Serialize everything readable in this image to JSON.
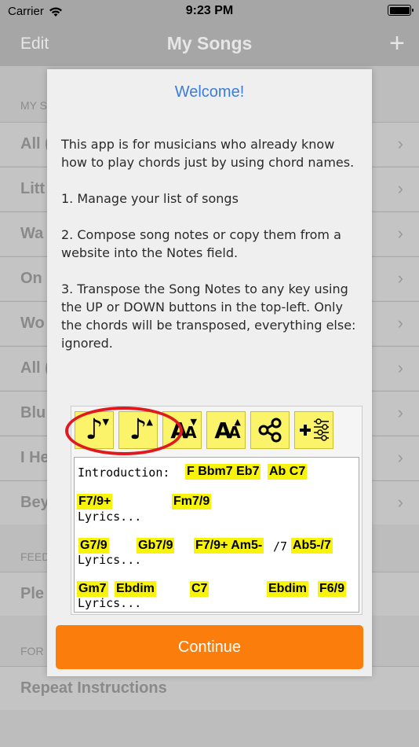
{
  "status": {
    "carrier": "Carrier",
    "time": "9:23 PM"
  },
  "nav": {
    "edit": "Edit",
    "title": "My Songs",
    "add": "+"
  },
  "list": {
    "section_my_songs": "MY S",
    "rows": [
      "All (",
      "Litt",
      "Wa",
      "On",
      "Wo",
      "All (",
      "Blu",
      "I He",
      "Bey"
    ],
    "section_feedback": "FEED",
    "feedback_row": "Ple",
    "section_for": "FOR",
    "repeat_row": "Repeat Instructions"
  },
  "dialog": {
    "title": "Welcome!",
    "paragraphs": [
      "This app is for musicians who already know how to play chords just by using chord names.",
      "1. Manage your list of songs",
      "2. Compose song notes or copy them from a website into the Notes field.",
      "3. Transpose the Song Notes to any key using the UP or DOWN buttons in the top-left. Only the chords will be transposed, everything else: ignored."
    ],
    "toolbar": {
      "transpose_down": "transpose-down-icon",
      "transpose_up": "transpose-up-icon",
      "font_smaller": "font-smaller-icon",
      "font_larger": "font-larger-icon",
      "share": "share-icon",
      "settings": "add-settings-icon"
    },
    "notes": {
      "intro_label": "Introduction:",
      "intro_chords": "F Bbm7 Eb7",
      "intro_chords2": "Ab C7",
      "line2_c1": "F7/9+",
      "line2_c2": "Fm7/9",
      "lyrics1": "Lyrics...",
      "line4_c1": "G7/9",
      "line4_c2": "Gb7/9",
      "line4_c3": "F7/9+ Am5-",
      "line4_plain": "/7",
      "line4_c4": "Ab5-/7",
      "lyrics2": "Lyrics...",
      "line6_c1": "Gm7",
      "line6_c2": "Ebdim",
      "line6_c3": "C7",
      "line6_c4": "Ebdim",
      "line6_c5": "F6/9",
      "lyrics3": "Lyrics..."
    },
    "continue": "Continue"
  }
}
